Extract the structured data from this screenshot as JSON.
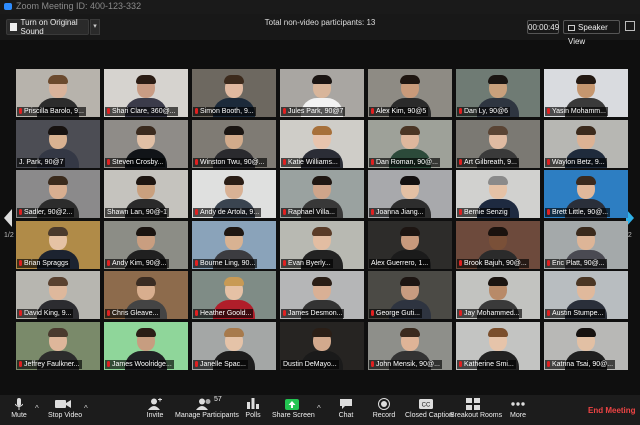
{
  "window": {
    "title": "Zoom Meeting ID: 400-123-332"
  },
  "toolbar": {
    "original_sound_label": "Turn on Original Sound",
    "non_video_label": "Total non-video participants: 13",
    "timer": "00:00:49",
    "speaker_view_label": "Speaker View"
  },
  "pagination": {
    "left": "1/2",
    "right": "1/2"
  },
  "participants": [
    {
      "name": "Priscilla Barolo, 9...",
      "bg": "#b7b3ac",
      "skin": "#d9b39b",
      "hair": "#6b4a2e",
      "shirt": "#2c2c2c",
      "muted": true
    },
    {
      "name": "Shari Clare, 360@...",
      "bg": "#d6d3cf",
      "skin": "#c99c84",
      "hair": "#2b1c14",
      "shirt": "#3b3b4a",
      "muted": true
    },
    {
      "name": "Simon Booth, 9...",
      "bg": "#6d6860",
      "skin": "#e0b9a0",
      "hair": "#3c2a1c",
      "shirt": "#1c2a3a",
      "muted": true
    },
    {
      "name": "Jules Park, 90@7",
      "bg": "#a9a6a2",
      "skin": "#d8b59a",
      "hair": "#1a1412",
      "shirt": "#f2f2f2",
      "muted": true
    },
    {
      "name": "Alex Kim, 90@5",
      "bg": "#8e8b84",
      "skin": "#c99a7a",
      "hair": "#1e1510",
      "shirt": "#2a2a2a",
      "muted": true
    },
    {
      "name": "Dan Ly, 90@6",
      "bg": "#6f7b74",
      "skin": "#c8a07c",
      "hair": "#1a1512",
      "shirt": "#2e3540",
      "muted": true,
      "active": true
    },
    {
      "name": "Yasin Mohamm...",
      "bg": "#d9dbdf",
      "skin": "#c6976f",
      "hair": "#221812",
      "shirt": "#3a3a3a",
      "muted": true
    },
    {
      "name": "J. Park, 90@7",
      "bg": "#4c4d54",
      "skin": "#d9b291",
      "hair": "#171210",
      "shirt": "#343845",
      "muted": false
    },
    {
      "name": "Steven Crosby...",
      "bg": "#8f8c88",
      "skin": "#e0bfa5",
      "hair": "#3a2a1e",
      "shirt": "#111418",
      "muted": true
    },
    {
      "name": "Winston Twu, 90@...",
      "bg": "#7f7b74",
      "skin": "#d2ab8b",
      "hair": "#1a1512",
      "shirt": "#2a2a2e",
      "muted": true
    },
    {
      "name": "Katie Williams...",
      "bg": "#cfcdc8",
      "skin": "#e8c4ad",
      "hair": "#a7703a",
      "shirt": "#2b2d36",
      "muted": true
    },
    {
      "name": "Dan Roman, 90@...",
      "bg": "#9ea199",
      "skin": "#deb79d",
      "hair": "#4a3524",
      "shirt": "#2c4a3a",
      "muted": true
    },
    {
      "name": "Art Gilbreath, 9...",
      "bg": "#7b7973",
      "skin": "#e0bba2",
      "hair": "#5a4434",
      "shirt": "#3a3a3a",
      "muted": true
    },
    {
      "name": "Waylon Betz, 9...",
      "bg": "#b7b7b3",
      "skin": "#dcb294",
      "hair": "#3b2a1c",
      "shirt": "#1f2b3c",
      "muted": true
    },
    {
      "name": "Sadler, 90@2...",
      "bg": "#8b8a8b",
      "skin": "#d8ae90",
      "hair": "#3a2a1c",
      "shirt": "#2c2c2c",
      "muted": true
    },
    {
      "name": "Shawn Lan, 90@-1",
      "bg": "#c5c3be",
      "skin": "#c9a07e",
      "hair": "#1d1511",
      "shirt": "#2a2a2a",
      "muted": false
    },
    {
      "name": "Andy de Artola, 9...",
      "bg": "#dfe0df",
      "skin": "#d9b295",
      "hair": "#2a1e16",
      "shirt": "#3a4450",
      "muted": true
    },
    {
      "name": "Raphael Villa...",
      "bg": "#9aa2a0",
      "skin": "#cfa58a",
      "hair": "#1f1712",
      "shirt": "#383838",
      "muted": true
    },
    {
      "name": "Joanna Jiang...",
      "bg": "#a8a9ac",
      "skin": "#e3c0a4",
      "hair": "#131010",
      "shirt": "#2d2d2d",
      "muted": true
    },
    {
      "name": "Bernie Senzig",
      "bg": "#d1d1cf",
      "skin": "#e5c2a6",
      "hair": "#8a8a8a",
      "shirt": "#1e2a40",
      "muted": true
    },
    {
      "name": "Brett Little, 90@...",
      "bg": "#2d7ec2",
      "skin": "#e0b89b",
      "hair": "#3a2a1e",
      "shirt": "#2a2f3a",
      "muted": true
    },
    {
      "name": "Brian Spraggs",
      "bg": "#b08b48",
      "skin": "#e5c2a4",
      "hair": "#4a3a2c",
      "shirt": "#1c2330",
      "muted": true
    },
    {
      "name": "Andy Kim, 90@...",
      "bg": "#8c8d86",
      "skin": "#c99e80",
      "hair": "#1a1410",
      "shirt": "#202020",
      "muted": true
    },
    {
      "name": "Bourne Ling, 90...",
      "bg": "#8aa3ba",
      "skin": "#d8b292",
      "hair": "#1f1712",
      "shirt": "#3c3c40",
      "muted": true
    },
    {
      "name": "Evan Byerly...",
      "bg": "#b8b9b2",
      "skin": "#e2bda2",
      "hair": "#5a3c28",
      "shirt": "#222",
      "muted": true
    },
    {
      "name": "Alex Guerrero, 1...",
      "bg": "#2d2c2a",
      "skin": "#c89a7d",
      "hair": "#1d1512",
      "shirt": "#1b1b1b",
      "muted": false
    },
    {
      "name": "Brook Bajuh, 90@...",
      "bg": "#6d4a3c",
      "skin": "#7a5038",
      "hair": "#1a120e",
      "shirt": "#2b2b2b",
      "muted": true
    },
    {
      "name": "Eric Platt, 90@...",
      "bg": "#a4a9aa",
      "skin": "#ddb597",
      "hair": "#3a2a1c",
      "shirt": "#4a4a52",
      "muted": true
    },
    {
      "name": "David King, 9...",
      "bg": "#b7b6b0",
      "skin": "#deb89c",
      "hair": "#5a4230",
      "shirt": "#2c2c30",
      "muted": true
    },
    {
      "name": "Chris Gleave...",
      "bg": "#8d6b4c",
      "skin": "#d8ae8e",
      "hair": "#3a2c22",
      "shirt": "#444",
      "muted": true
    },
    {
      "name": "Heather Goold...",
      "bg": "#7f8c86",
      "skin": "#e5c1a5",
      "hair": "#c89a55",
      "shirt": "#b01e2a",
      "muted": true
    },
    {
      "name": "James Desmon...",
      "bg": "#b5b6b7",
      "skin": "#d9b095",
      "hair": "#2a1e16",
      "shirt": "#333",
      "muted": true
    },
    {
      "name": "George Guti...",
      "bg": "#4b4a45",
      "skin": "#c89c80",
      "hair": "#1d1512",
      "shirt": "#2e3440",
      "muted": true
    },
    {
      "name": "Jay Mohammed...",
      "bg": "#c2c3c0",
      "skin": "#b88a68",
      "hair": "#1a1410",
      "shirt": "#3a3a3a",
      "muted": true
    },
    {
      "name": "Austin Stumpe...",
      "bg": "#b8bdc0",
      "skin": "#e0b99c",
      "hair": "#4a3624",
      "shirt": "#2a2f3a",
      "muted": true
    },
    {
      "name": "Jeffrey Faulkner...",
      "bg": "#7a8a6a",
      "skin": "#deb69a",
      "hair": "#4a3a2e",
      "shirt": "#2c2c2c",
      "muted": true
    },
    {
      "name": "James Woolridge...",
      "bg": "#8fd69a",
      "skin": "#c79d80",
      "hair": "#2a1e16",
      "shirt": "#202225",
      "muted": true
    },
    {
      "name": "Janelle Spac...",
      "bg": "#a4a7a6",
      "skin": "#e5c3a8",
      "hair": "#a77a4c",
      "shirt": "#1d1d1d",
      "muted": true
    },
    {
      "name": "Dustin DeMayo...",
      "bg": "#262422",
      "skin": "#d2a98d",
      "hair": "#2a1e16",
      "shirt": "#1a1a1a",
      "muted": false
    },
    {
      "name": "John Mensik, 90@...",
      "bg": "#8e8f8a",
      "skin": "#deb497",
      "hair": "#3a2a1e",
      "shirt": "#333",
      "muted": true
    },
    {
      "name": "Katherine Smi...",
      "bg": "#c3c4c2",
      "skin": "#e6c4aa",
      "hair": "#7a4e2c",
      "shirt": "#222",
      "muted": true
    },
    {
      "name": "Katrina Tsai, 90@...",
      "bg": "#b8b8b6",
      "skin": "#e2c0a4",
      "hair": "#161210",
      "shirt": "#1f1f1f",
      "muted": true
    }
  ],
  "bottom_bar": {
    "mute": "Mute",
    "stop_video": "Stop Video",
    "invite": "Invite",
    "manage_participants": "Manage Participants",
    "participant_count": "57",
    "polls": "Polls",
    "share_screen": "Share Screen",
    "chat": "Chat",
    "record": "Record",
    "closed_caption": "Closed Caption",
    "breakout_rooms": "Breakout Rooms",
    "more": "More",
    "end_meeting": "End Meeting"
  },
  "colors": {
    "accent_blue": "#2d8cff",
    "active_speaker": "#b8e234",
    "end_red": "#e44444",
    "share_green": "#23c552"
  }
}
